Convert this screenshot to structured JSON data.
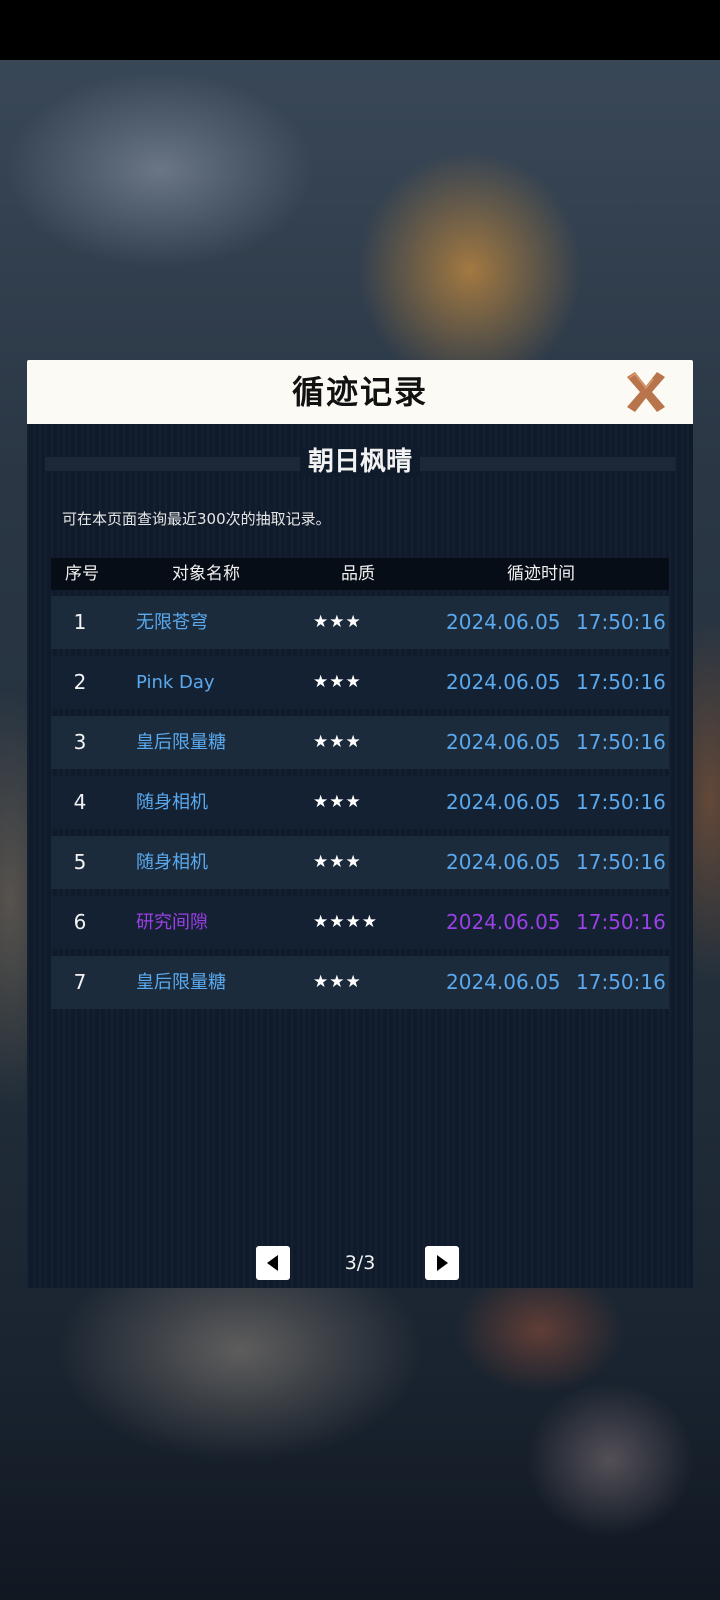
{
  "dialog": {
    "title": "循迹记录",
    "close_icon": "close-x-icon",
    "accent_color": "#b8744a"
  },
  "banner": {
    "name": "朝日枫晴"
  },
  "note": "可在本页面查询最近300次的抽取记录。",
  "table": {
    "headers": [
      "序号",
      "对象名称",
      "品质",
      "循迹时间"
    ],
    "rows": [
      {
        "index": "1",
        "name": "无限苍穹",
        "stars": "★★★",
        "rating": 3,
        "date": "2024.06.05",
        "time": "17:50:16"
      },
      {
        "index": "2",
        "name": "Pink Day",
        "stars": "★★★",
        "rating": 3,
        "date": "2024.06.05",
        "time": "17:50:16"
      },
      {
        "index": "3",
        "name": "皇后限量糖",
        "stars": "★★★",
        "rating": 3,
        "date": "2024.06.05",
        "time": "17:50:16"
      },
      {
        "index": "4",
        "name": "随身相机",
        "stars": "★★★",
        "rating": 3,
        "date": "2024.06.05",
        "time": "17:50:16"
      },
      {
        "index": "5",
        "name": "随身相机",
        "stars": "★★★",
        "rating": 3,
        "date": "2024.06.05",
        "time": "17:50:16"
      },
      {
        "index": "6",
        "name": "研究间隙",
        "stars": "★★★★",
        "rating": 4,
        "date": "2024.06.05",
        "time": "17:50:16"
      },
      {
        "index": "7",
        "name": "皇后限量糖",
        "stars": "★★★",
        "rating": 3,
        "date": "2024.06.05",
        "time": "17:50:16"
      }
    ],
    "colors": {
      "three_star": "#5aa9ee",
      "four_star": "#9b3fe6"
    }
  },
  "pagination": {
    "page_text": "3/3",
    "prev_icon": "triangle-left-icon",
    "next_icon": "triangle-right-icon"
  }
}
